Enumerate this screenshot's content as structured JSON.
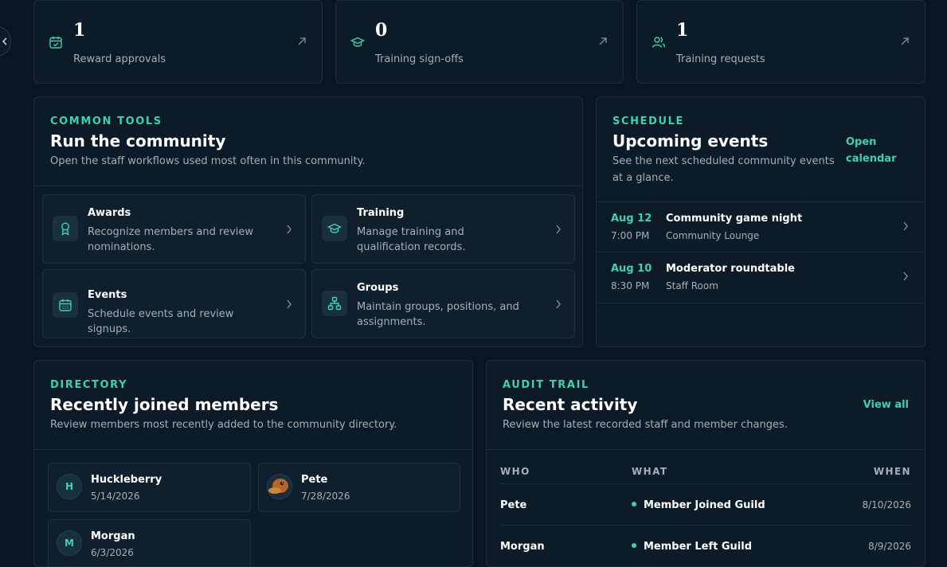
{
  "stats": [
    {
      "value": "1",
      "label": "Reward approvals",
      "icon": "calendar-check-icon"
    },
    {
      "value": "0",
      "label": "Training sign-offs",
      "icon": "graduation-cap-icon"
    },
    {
      "value": "1",
      "label": "Training requests",
      "icon": "users-icon"
    }
  ],
  "tools": {
    "eyebrow": "COMMON TOOLS",
    "title": "Run the community",
    "subtitle": "Open the staff workflows used most often in this community.",
    "items": [
      {
        "title": "Awards",
        "desc": "Recognize members and review nominations.",
        "icon": "award-icon"
      },
      {
        "title": "Training",
        "desc": "Manage training and qualification records.",
        "icon": "graduation-cap-icon"
      },
      {
        "title": "Events",
        "desc": "Schedule events and review signups.",
        "icon": "calendar-icon"
      },
      {
        "title": "Groups",
        "desc": "Maintain groups, positions, and assignments.",
        "icon": "org-chart-icon"
      }
    ]
  },
  "schedule": {
    "eyebrow": "SCHEDULE",
    "title": "Upcoming events",
    "subtitle": "See the next scheduled community events at a glance.",
    "link": "Open calendar",
    "events": [
      {
        "date": "Aug 12",
        "time": "7:00 PM",
        "name": "Community game night",
        "place": "Community Lounge"
      },
      {
        "date": "Aug 10",
        "time": "8:30 PM",
        "name": "Moderator roundtable",
        "place": "Staff Room"
      }
    ]
  },
  "directory": {
    "eyebrow": "DIRECTORY",
    "title": "Recently joined members",
    "subtitle": "Review members most recently added to the community directory.",
    "members": [
      {
        "initial": "H",
        "name": "Huckleberry",
        "date": "5/14/2026"
      },
      {
        "initial": "",
        "name": "Pete",
        "date": "7/28/2026"
      },
      {
        "initial": "M",
        "name": "Morgan",
        "date": "6/3/2026"
      }
    ]
  },
  "audit": {
    "eyebrow": "AUDIT TRAIL",
    "title": "Recent activity",
    "subtitle": "Review the latest recorded staff and member changes.",
    "link": "View all",
    "columns": {
      "who": "WHO",
      "what": "WHAT",
      "when": "WHEN"
    },
    "rows": [
      {
        "who": "Pete",
        "what": "Member Joined Guild",
        "when": "8/10/2026"
      },
      {
        "who": "Morgan",
        "what": "Member Left Guild",
        "when": "8/9/2026"
      }
    ]
  },
  "colors": {
    "accent": "#3fd0b3",
    "background": "#0a1521",
    "card": "#0d1a28"
  }
}
